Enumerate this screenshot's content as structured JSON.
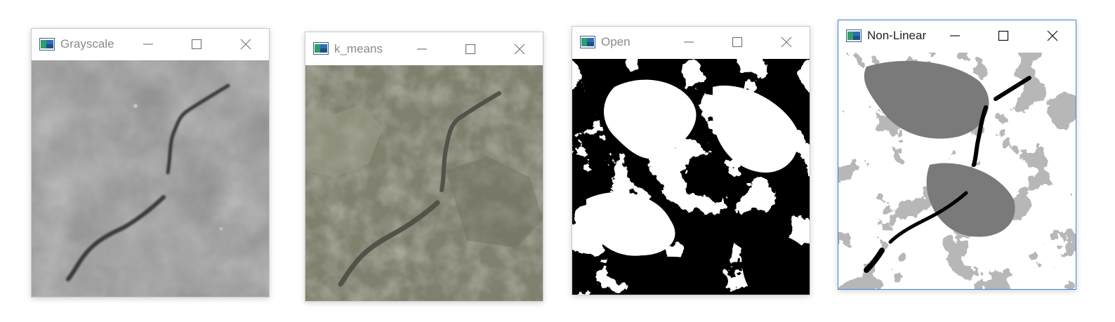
{
  "windows": [
    {
      "id": "grayscale",
      "title": "Grayscale",
      "active": false
    },
    {
      "id": "k_means",
      "title": "k_means",
      "active": false
    },
    {
      "id": "open",
      "title": "Open",
      "active": false
    },
    {
      "id": "non_linear",
      "title": "Non-Linear",
      "active": true
    }
  ],
  "icons": {
    "app": "opencv-window-icon",
    "minimize": "minimize-icon",
    "maximize": "maximize-icon",
    "close": "close-icon"
  },
  "colors": {
    "active_border": "#3a86d4",
    "grayscale_bg": "#8a8a8a",
    "kmeans_bg": "#80806f",
    "open_black": "#000000",
    "open_white": "#ffffff",
    "nonlinear_gray": "#7a7a7a"
  }
}
